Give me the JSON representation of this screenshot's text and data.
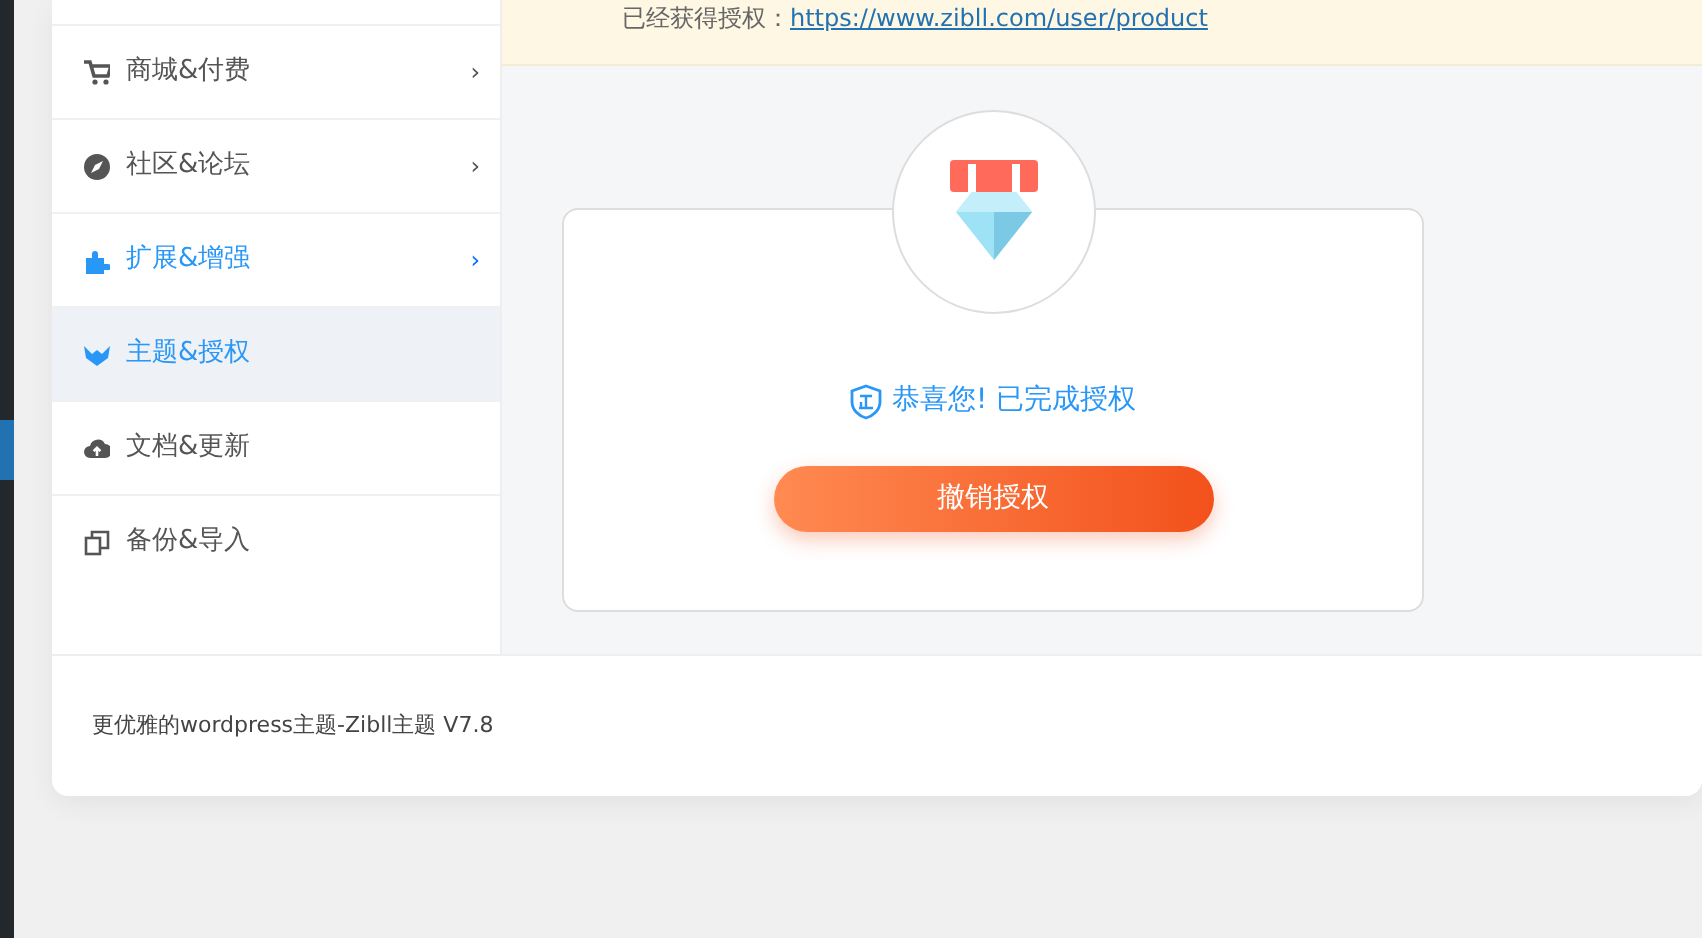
{
  "notice": {
    "text": "已经获得授权：",
    "link": "https://www.zibll.com/user/product"
  },
  "menu": [
    {
      "label": "商城&付费",
      "chevron": "›",
      "highlighted": false,
      "selected": false
    },
    {
      "label": "社区&论坛",
      "chevron": "›",
      "highlighted": false,
      "selected": false
    },
    {
      "label": "扩展&增强",
      "chevron": "›",
      "highlighted": true,
      "selected": false
    },
    {
      "label": "主题&授权",
      "highlighted": true,
      "selected": true
    },
    {
      "label": "文档&更新",
      "highlighted": false,
      "selected": false
    },
    {
      "label": "备份&导入",
      "highlighted": false,
      "selected": false
    }
  ],
  "license": {
    "message": "恭喜您! 已完成授权",
    "button": "撤销授权"
  },
  "footer": "更优雅的wordpress主题-Zibll主题 V7.8"
}
